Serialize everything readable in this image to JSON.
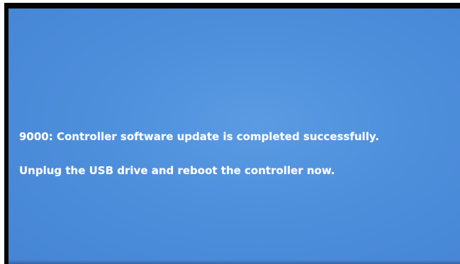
{
  "screen": {
    "background_color": "#4e8fdc",
    "text_color": "#ffffff",
    "messages": [
      "9000: Controller software update is completed successfully.",
      "Unplug the USB drive and reboot the controller now."
    ]
  }
}
